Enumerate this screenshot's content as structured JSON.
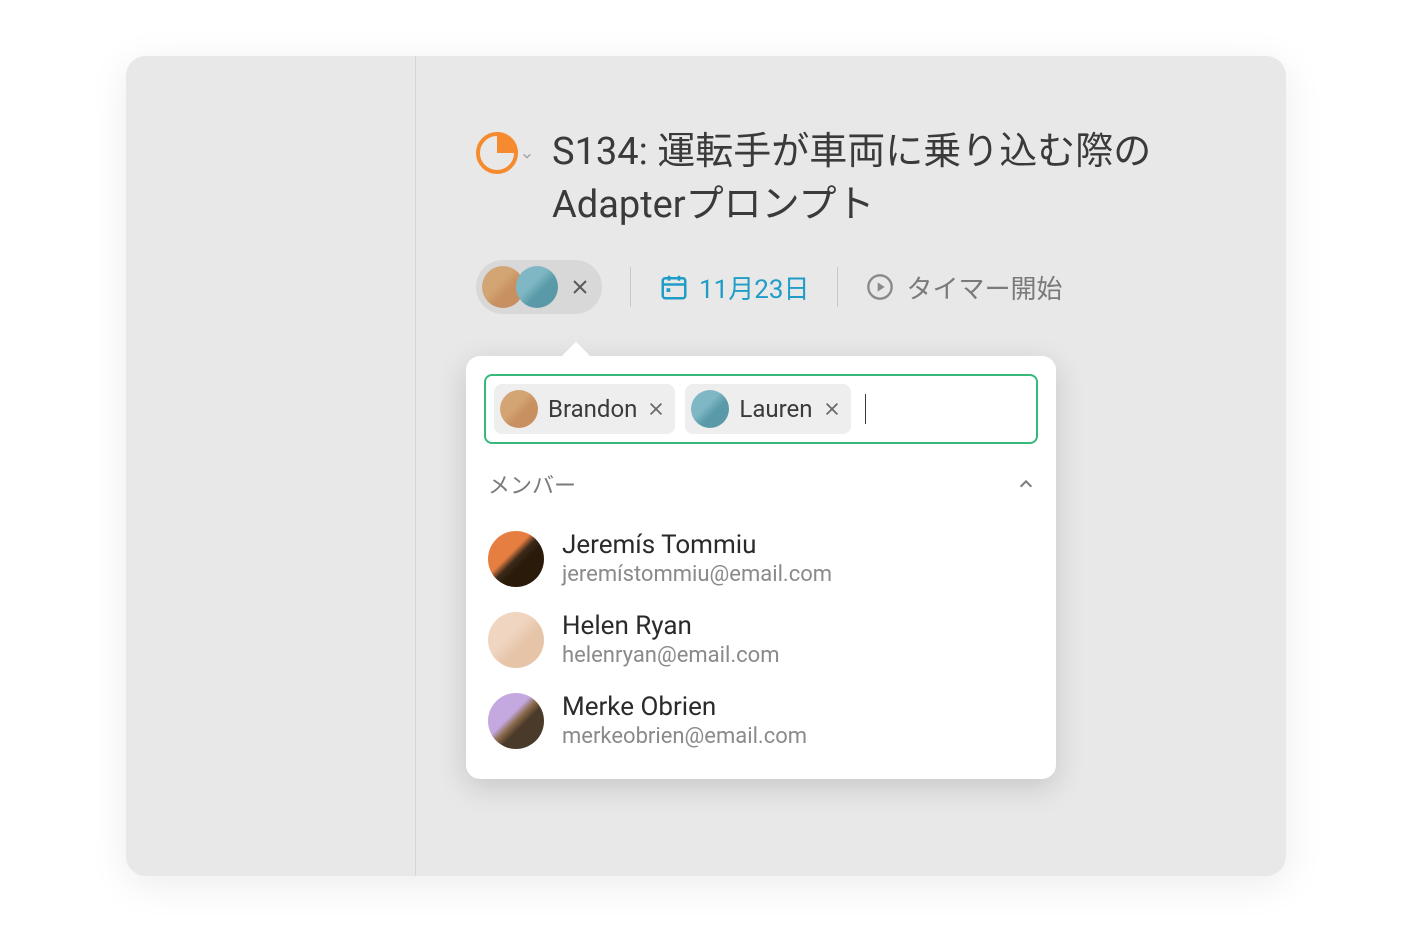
{
  "task": {
    "title": "S134: 運転手が車両に乗り込む際のAdapterプロンプト",
    "date_label": "11月23日",
    "timer_label": "タイマー開始"
  },
  "assignees": {
    "selected": [
      {
        "name": "Brandon",
        "avatar": "avatar-1"
      },
      {
        "name": "Lauren",
        "avatar": "avatar-2"
      }
    ]
  },
  "dropdown": {
    "section_label": "メンバー",
    "members": [
      {
        "name": "Jeremís Tommiu",
        "email": "jeremístommiu@email.com",
        "avatar": "avatar-3"
      },
      {
        "name": "Helen Ryan",
        "email": "helenryan@email.com",
        "avatar": "avatar-4"
      },
      {
        "name": "Merke Obrien",
        "email": "merkeobrien@email.com",
        "avatar": "avatar-5"
      }
    ]
  }
}
